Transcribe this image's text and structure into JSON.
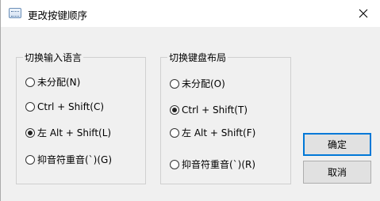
{
  "window": {
    "title": "更改按键顺序"
  },
  "input_language_group": {
    "legend": "切换输入语言",
    "options": [
      {
        "label": "未分配(N)",
        "checked": false
      },
      {
        "label": "Ctrl + Shift(C)",
        "checked": false
      },
      {
        "label": "左 Alt + Shift(L)",
        "checked": true
      },
      {
        "label": "抑音符重音(`)(G)",
        "checked": false
      }
    ]
  },
  "keyboard_layout_group": {
    "legend": "切换键盘布局",
    "options": [
      {
        "label": "未分配(O)",
        "checked": false
      },
      {
        "label": "Ctrl + Shift(T)",
        "checked": true
      },
      {
        "label": "左 Alt + Shift(F)",
        "checked": false
      },
      {
        "label": "抑音符重音(`)(R)",
        "checked": false
      }
    ]
  },
  "buttons": {
    "ok": "确定",
    "cancel": "取消"
  },
  "icons": {
    "app": "keyboard-icon",
    "close": "close-icon"
  }
}
